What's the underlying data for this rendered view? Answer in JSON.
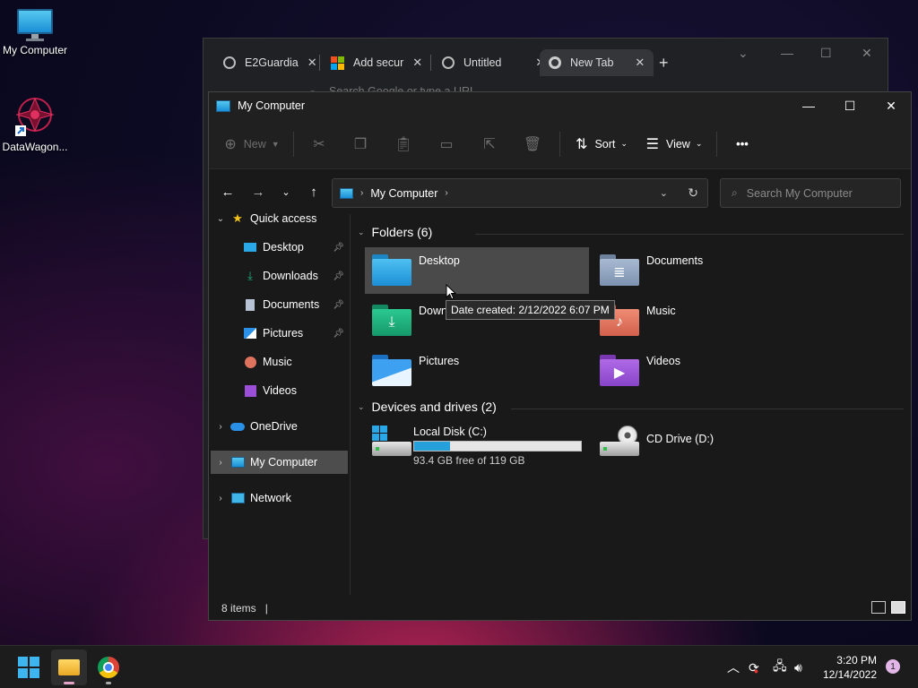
{
  "desktop": {
    "icons": [
      {
        "label": "My Computer"
      },
      {
        "label": "DataWagon..."
      }
    ]
  },
  "chrome": {
    "tabs": [
      {
        "title": "E2Guardia"
      },
      {
        "title": "Add secur"
      },
      {
        "title": "Untitled"
      },
      {
        "title": "New Tab"
      }
    ],
    "new_tab": "+",
    "omnibox_placeholder": "Search Google or type a URL"
  },
  "explorer": {
    "title": "My Computer",
    "toolbar": {
      "new_label": "New",
      "sort_label": "Sort",
      "view_label": "View",
      "more": "•••"
    },
    "address": {
      "path": "My Computer"
    },
    "search": {
      "placeholder": "Search My Computer"
    },
    "sidebar": {
      "quick_access": "Quick access",
      "items": [
        {
          "label": "Desktop"
        },
        {
          "label": "Downloads"
        },
        {
          "label": "Documents"
        },
        {
          "label": "Pictures"
        },
        {
          "label": "Music"
        },
        {
          "label": "Videos"
        }
      ],
      "onedrive": "OneDrive",
      "my_computer": "My Computer",
      "network": "Network"
    },
    "folders": {
      "header": "Folders (6)",
      "items": [
        {
          "name": "Desktop",
          "color": "#2aa7e6"
        },
        {
          "name": "Documents",
          "color": "#8fa4c2"
        },
        {
          "name": "Downl",
          "color": "#1fae7e"
        },
        {
          "name": "Music",
          "color": "#e0735e"
        },
        {
          "name": "Pictures",
          "color": "#2a8fe6"
        },
        {
          "name": "Videos",
          "color": "#9a4fd6"
        }
      ]
    },
    "drives": {
      "header": "Devices and drives (2)",
      "local": {
        "name": "Local Disk (C:)",
        "free": "93.4 GB free of 119 GB",
        "used_fraction": 0.215
      },
      "cd": {
        "name": "CD Drive (D:)"
      }
    },
    "tooltip": "Date created: 2/12/2022 6:07 PM",
    "status": {
      "items": "8 items",
      "cursor": "|"
    }
  },
  "taskbar": {
    "time": "3:20 PM",
    "date": "12/14/2022",
    "notifications": "1"
  }
}
